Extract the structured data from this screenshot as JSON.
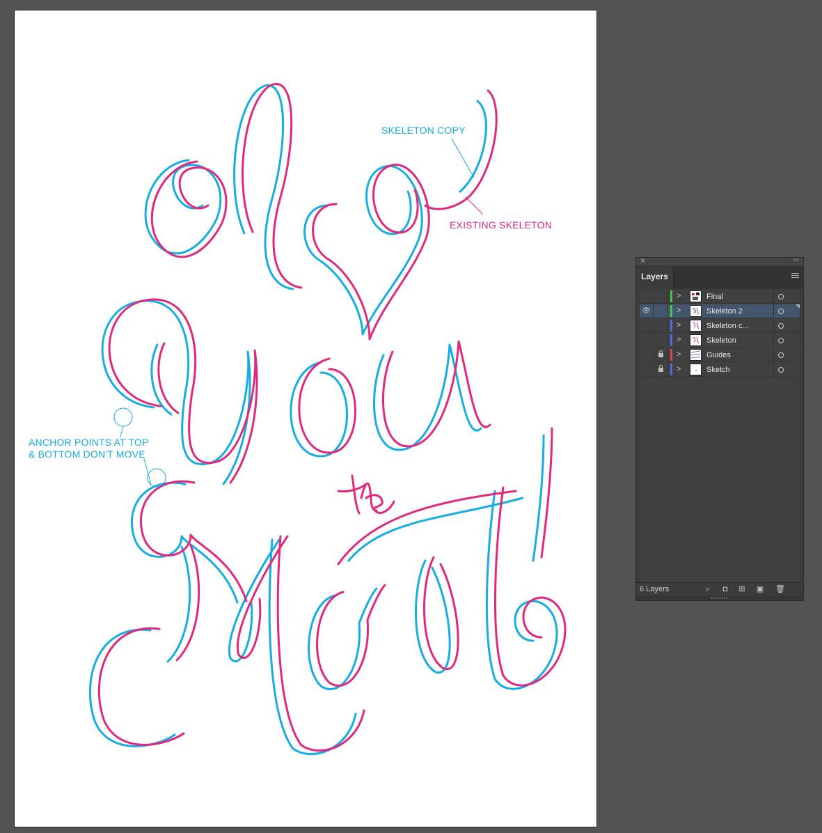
{
  "canvas": {
    "annotations": {
      "skeleton_copy": "SKELETON COPY",
      "existing_skeleton": "EXISTING SKELETON",
      "anchor_points": "ANCHOR POINTS AT TOP\n& BOTTOM DON'T MOVE"
    },
    "colors": {
      "skeleton": "#e0297e",
      "skeleton_copy": "#16ace4"
    }
  },
  "layers_panel": {
    "tab_label": "Layers",
    "count_label": "6 Layers",
    "layers": [
      {
        "name": "Final",
        "color": "#43c943",
        "visible": false,
        "locked": false,
        "selected": false
      },
      {
        "name": "Skeleton 2",
        "color": "#43c943",
        "visible": true,
        "locked": false,
        "selected": true
      },
      {
        "name": "Skeleton c...",
        "color": "#4a6ee0",
        "visible": false,
        "locked": false,
        "selected": false
      },
      {
        "name": "Skeleton",
        "color": "#4a6ee0",
        "visible": false,
        "locked": false,
        "selected": false
      },
      {
        "name": "Guides",
        "color": "#e04545",
        "visible": false,
        "locked": true,
        "selected": false
      },
      {
        "name": "Sketch",
        "color": "#4a6ee0",
        "visible": false,
        "locked": true,
        "selected": false
      }
    ],
    "footer_icons": [
      "locate-object-icon",
      "make-clipping-mask-icon",
      "new-sublayer-icon",
      "new-layer-icon",
      "trash-icon"
    ]
  }
}
